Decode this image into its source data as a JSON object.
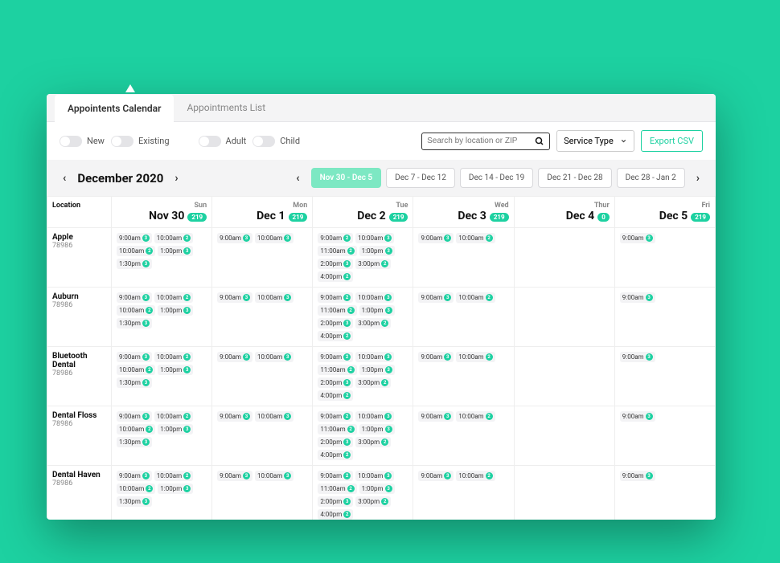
{
  "tabs": {
    "active": "Appointents Calendar",
    "inactive": "Appointments List"
  },
  "filters": {
    "new": "New",
    "existing": "Existing",
    "adult": "Adult",
    "child": "Child"
  },
  "search": {
    "placeholder": "Search by location or ZIP"
  },
  "service_type": {
    "label": "Service Type"
  },
  "export": {
    "label": "Export CSV"
  },
  "month": "December 2020",
  "weeks": [
    {
      "label": "Nov 30 - Dec 5",
      "active": true
    },
    {
      "label": "Dec 7 - Dec 12",
      "active": false
    },
    {
      "label": "Dec 14 - Dec 19",
      "active": false
    },
    {
      "label": "Dec 21 - Dec 28",
      "active": false
    },
    {
      "label": "Dec 28 - Jan 2",
      "active": false
    }
  ],
  "location_header": "Location",
  "days": [
    {
      "dow": "Sun",
      "date": "Nov 30",
      "count": "219"
    },
    {
      "dow": "Mon",
      "date": "Dec 1",
      "count": "219"
    },
    {
      "dow": "Tue",
      "date": "Dec 2",
      "count": "219"
    },
    {
      "dow": "Wed",
      "date": "Dec 3",
      "count": "219"
    },
    {
      "dow": "Thur",
      "date": "Dec 4",
      "count": "0"
    },
    {
      "dow": "Fri",
      "date": "Dec 5",
      "count": "219"
    }
  ],
  "locations": [
    {
      "name": "Apple",
      "zip": "78986"
    },
    {
      "name": "Auburn",
      "zip": "78986"
    },
    {
      "name": "Bluetooth Dental",
      "zip": "78986"
    },
    {
      "name": "Dental Floss",
      "zip": "78986"
    },
    {
      "name": "Dental Haven",
      "zip": "78986"
    }
  ],
  "slot_sets": {
    "sun": [
      {
        "t": "9:00am",
        "c": "3"
      },
      {
        "t": "10:00am",
        "c": "2"
      },
      {
        "t": "10:00am",
        "c": "2"
      },
      {
        "t": "1:00pm",
        "c": "3"
      },
      {
        "t": "1:30pm",
        "c": "3"
      }
    ],
    "mon": [
      {
        "t": "9:00am",
        "c": "3"
      },
      {
        "t": "10:00am",
        "c": "3"
      }
    ],
    "tue": [
      {
        "t": "9:00am",
        "c": "2"
      },
      {
        "t": "10:00am",
        "c": "3"
      },
      {
        "t": "11:00am",
        "c": "2"
      },
      {
        "t": "1:00pm",
        "c": "3"
      },
      {
        "t": "2:00pm",
        "c": "3"
      },
      {
        "t": "3:00pm",
        "c": "2"
      },
      {
        "t": "4:00pm",
        "c": "2"
      }
    ],
    "wed": [
      {
        "t": "9:00am",
        "c": "3"
      },
      {
        "t": "10:00am",
        "c": "2"
      }
    ],
    "thu": [],
    "fri": [
      {
        "t": "9:00am",
        "c": "3"
      }
    ]
  }
}
